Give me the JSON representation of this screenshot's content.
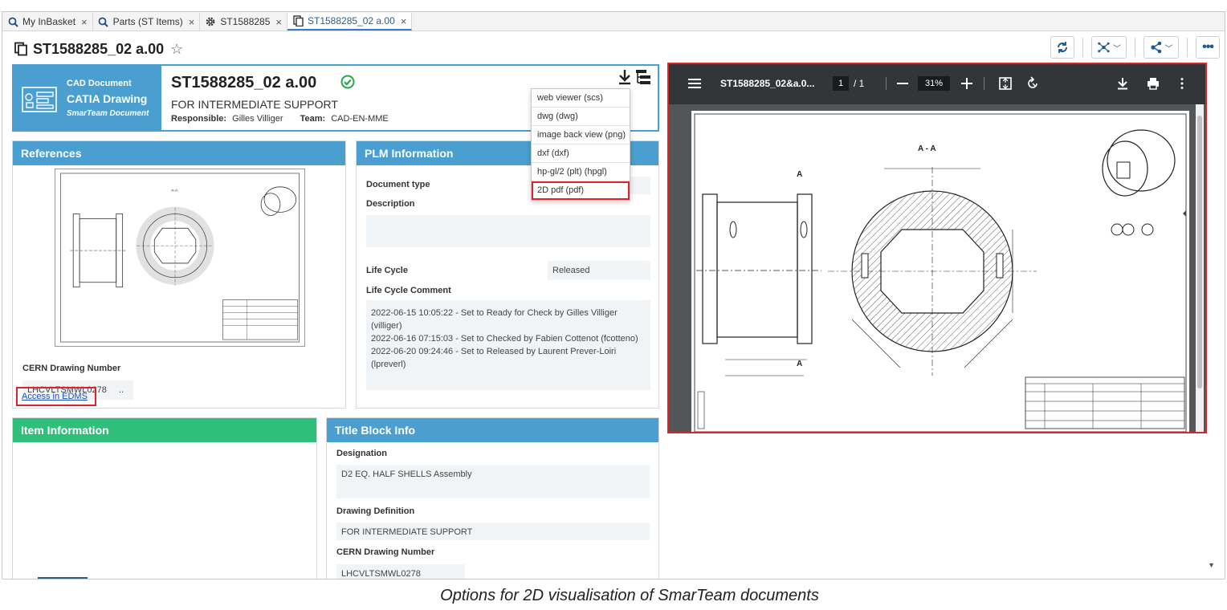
{
  "tabs": [
    {
      "label": "My InBasket",
      "icon": "search-icon"
    },
    {
      "label": "Parts (ST Items)",
      "icon": "search-icon"
    },
    {
      "label": "ST1588285",
      "icon": "gear-icon"
    },
    {
      "label": "ST1588285_02 a.00",
      "icon": "document-copy-icon",
      "active": true
    }
  ],
  "page_title": "ST1588285_02 a.00",
  "header": {
    "doc_kind": "CAD Document",
    "doc_type": "CATIA Drawing",
    "doc_sub": "SmarTeam Document",
    "doc_number": "ST1588285_02  a.00",
    "subtitle": "FOR INTERMEDIATE SUPPORT",
    "responsible_label": "Responsible:",
    "responsible_value": "Gilles Villiger",
    "team_label": "Team:",
    "team_value": "CAD-EN-MME"
  },
  "download_menu": {
    "options": [
      "web viewer (scs)",
      "dwg (dwg)",
      "image back view (png)",
      "dxf (dxf)",
      "hp-gl/2 (plt) (hpgl)",
      "2D pdf (pdf)"
    ],
    "highlighted": "2D pdf (pdf)"
  },
  "references": {
    "title": "References",
    "cern_label": "CERN Drawing Number",
    "cern_value": "LHCVLTSMWL0278",
    "cern_more": "..",
    "edms_link": "Access in EDMS"
  },
  "plm": {
    "title": "PLM Information",
    "doc_type_label": "Document type",
    "description_label": "Description",
    "lifecycle_label": "Life Cycle",
    "lifecycle_value": "Released",
    "lc_comment_label": "Life Cycle Comment",
    "lc_comments": [
      "2022-06-15 10:05:22 - Set to Ready for Check by Gilles Villiger (villiger)",
      "2022-06-16 07:15:03 - Set to Checked by Fabien Cottenot (fcotteno)",
      "2022-06-20 09:24:46 - Set to Released by Laurent Prever-Loiri (lpreverl)"
    ]
  },
  "item_info": {
    "title": "Item Information"
  },
  "title_block": {
    "title": "Title Block Info",
    "designation_label": "Designation",
    "designation_value": "D2 EQ. HALF SHELLS Assembly",
    "drawing_def_label": "Drawing Definition",
    "drawing_def_value": "FOR INTERMEDIATE SUPPORT",
    "cern_label": "CERN Drawing Number",
    "cern_value": "LHCVLTSMWL0278"
  },
  "viewer": {
    "filename": "ST1588285_02&a.0...",
    "page": "1",
    "page_total": "/  1",
    "zoom": "31%"
  },
  "caption": "Options for 2D visualisation of SmarTeam documents",
  "colors": {
    "accent": "#4a9fd0",
    "green": "#2fbf7b",
    "highlight": "#d9262c"
  }
}
